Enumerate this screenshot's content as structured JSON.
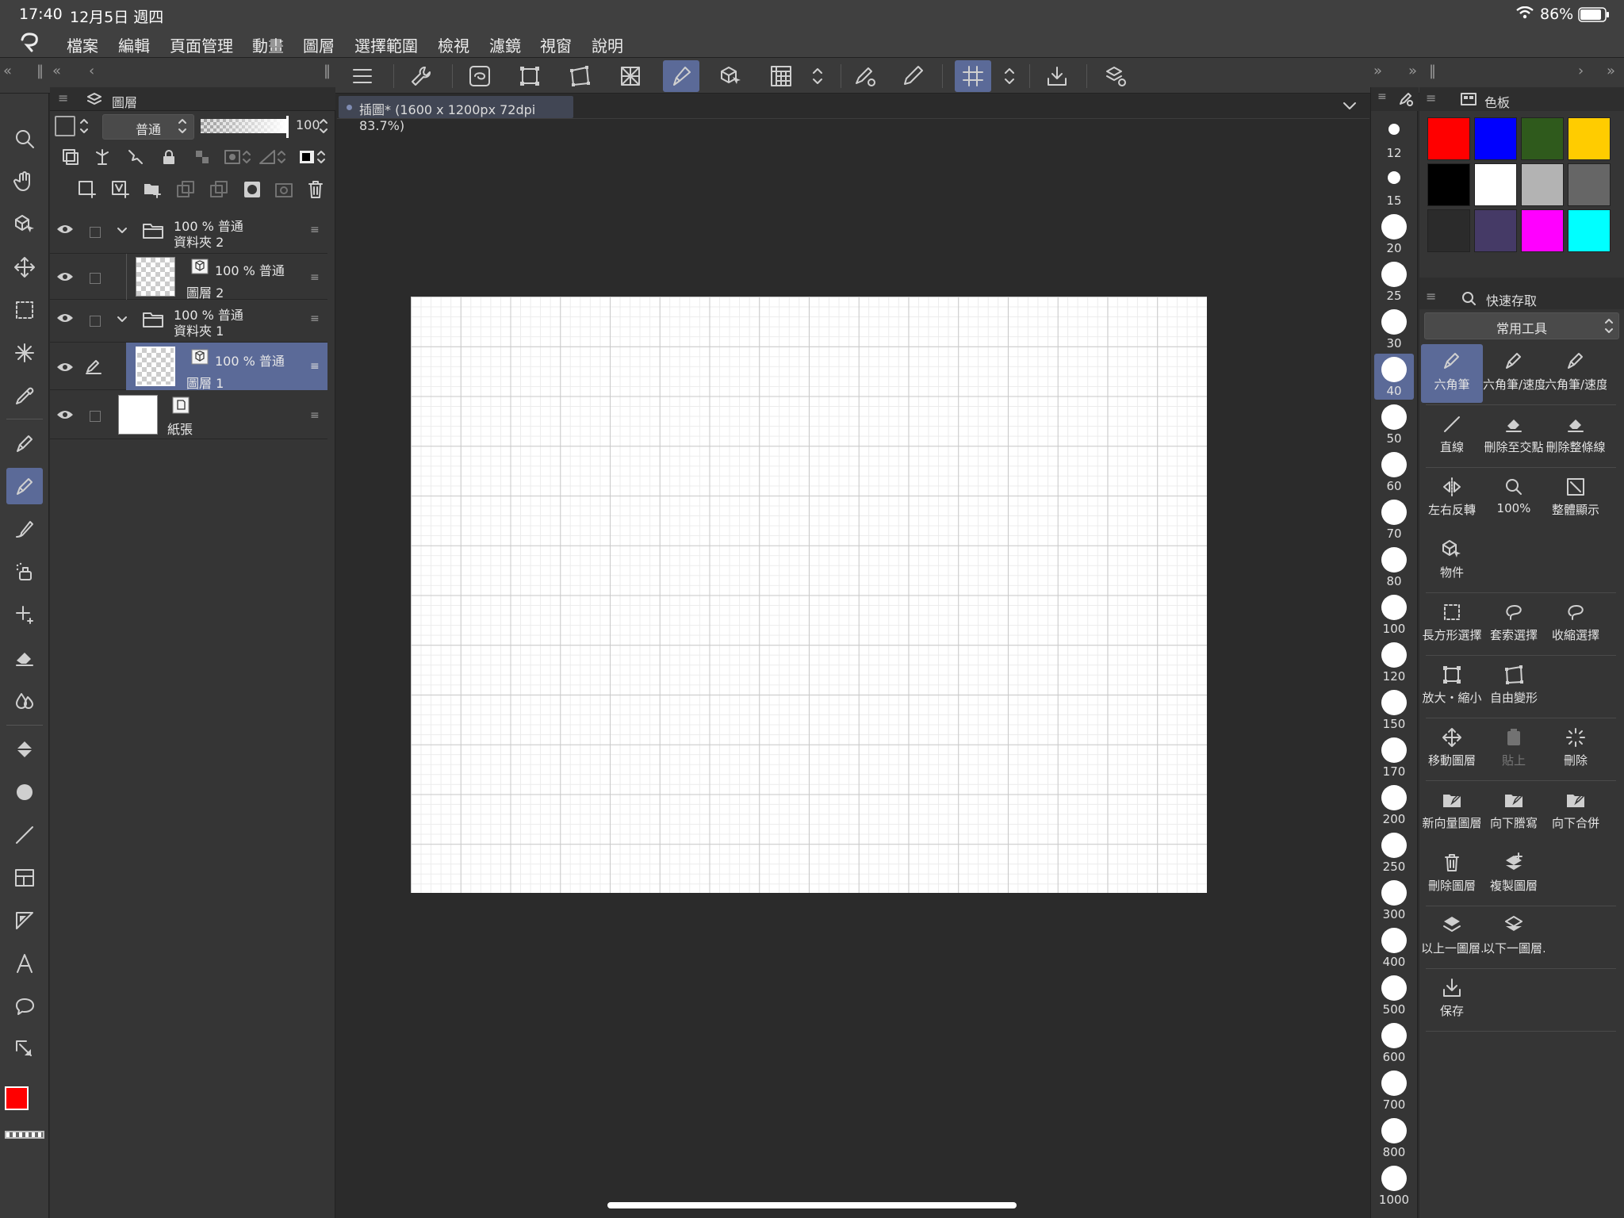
{
  "status": {
    "time": "17:40",
    "date": "12月5日 週四",
    "battery": "86%"
  },
  "menu": [
    "檔案",
    "編輯",
    "頁面管理",
    "動畫",
    "圖層",
    "選擇範圍",
    "檢視",
    "濾鏡",
    "視窗",
    "說明"
  ],
  "layer_panel": {
    "title": "圖層",
    "blend_mode": "普通",
    "opacity": "100",
    "layers": [
      {
        "info": "100 % 普通",
        "name": "資料夾 2"
      },
      {
        "info": "100 % 普通",
        "name": "圖層 2"
      },
      {
        "info": "100 % 普通",
        "name": "資料夾 1"
      },
      {
        "info": "100 % 普通",
        "name": "圖層 1"
      },
      {
        "info": "",
        "name": "紙張"
      }
    ]
  },
  "document_tab": "插圖* (1600 x 1200px 72dpi 83.7%)",
  "brush_sizes": [
    "12",
    "15",
    "20",
    "25",
    "30",
    "40",
    "50",
    "60",
    "70",
    "80",
    "100",
    "120",
    "150",
    "170",
    "200",
    "250",
    "300",
    "400",
    "500",
    "600",
    "700",
    "800",
    "1000"
  ],
  "brush_size_selected": "40",
  "color_panel": {
    "title": "色板",
    "swatches": [
      "#ff0000",
      "#0000ff",
      "#2f5a1c",
      "#ffcc00",
      "#000000",
      "#ffffff",
      "#b3b3b3",
      "#666666",
      "#2b2b2b",
      "#453a66",
      "#ff00ff",
      "#00ffff"
    ]
  },
  "quick_access": {
    "title": "快速存取",
    "set": "常用工具",
    "items": [
      [
        "六角筆",
        "六角筆/速度",
        "六角筆/速度"
      ],
      [
        "直線",
        "刪除至交點",
        "刪除整條線"
      ],
      [
        "左右反轉",
        "100%",
        "整體顯示"
      ],
      [
        "物件"
      ],
      [
        "長方形選擇",
        "套索選擇",
        "收縮選擇"
      ],
      [
        "放大・縮小",
        "自由變形"
      ],
      [
        "移動圖層",
        "貼上",
        "刪除"
      ],
      [
        "新向量圖層",
        "向下謄寫",
        "向下合併"
      ],
      [
        "刪除圖層",
        "複製圖層"
      ],
      [
        "以上一圖層…",
        "以下一圖層…"
      ],
      [
        "保存"
      ]
    ]
  }
}
